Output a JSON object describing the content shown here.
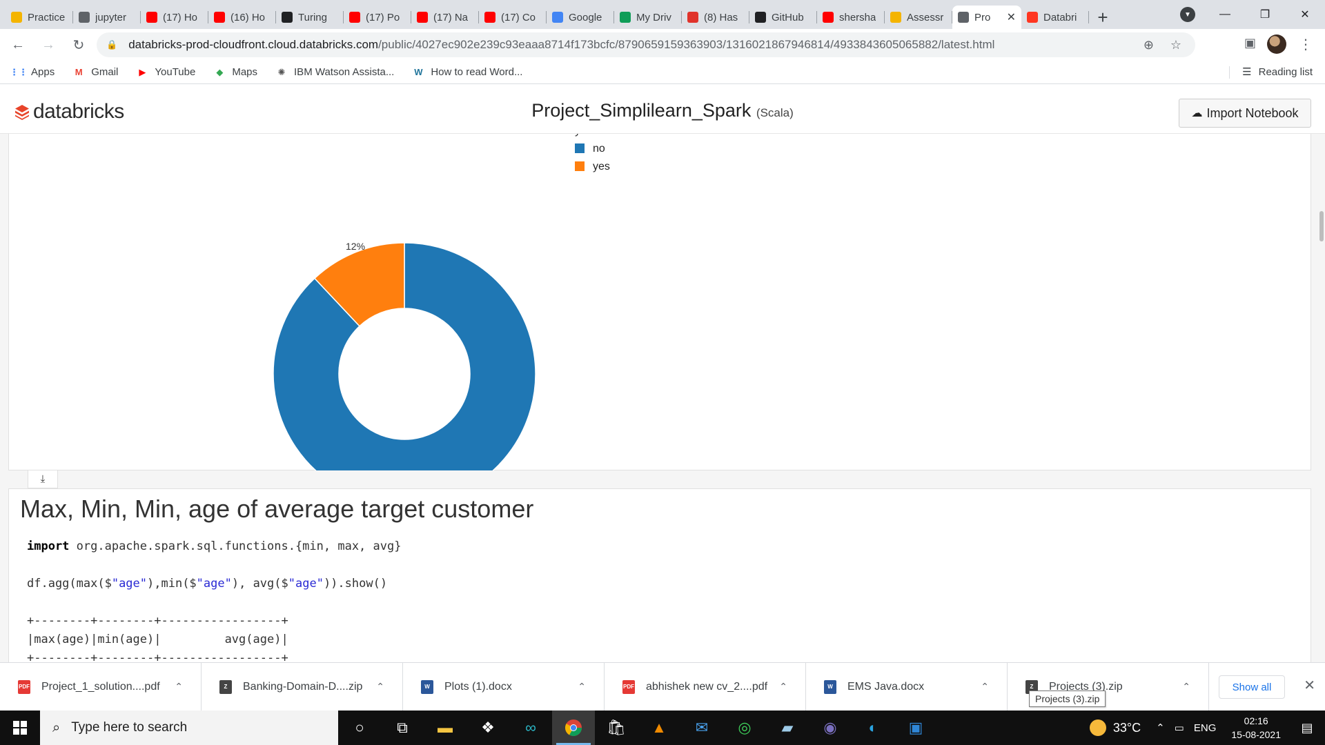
{
  "browser": {
    "tabs": [
      {
        "title": "Practice",
        "icon": "chart-bars-icon",
        "color": "#f4b400"
      },
      {
        "title": "jupyter",
        "icon": "globe-icon",
        "color": "#5f6368"
      },
      {
        "title": "(17) Ho",
        "icon": "youtube-icon",
        "color": "#ff0000"
      },
      {
        "title": "(16) Ho",
        "icon": "youtube-icon",
        "color": "#ff0000"
      },
      {
        "title": "Turing",
        "icon": "turing-icon",
        "color": "#202124"
      },
      {
        "title": "(17) Po",
        "icon": "youtube-icon",
        "color": "#ff0000"
      },
      {
        "title": "(17) Na",
        "icon": "youtube-icon",
        "color": "#ff0000"
      },
      {
        "title": "(17) Co",
        "icon": "youtube-icon",
        "color": "#ff0000"
      },
      {
        "title": "Google",
        "icon": "google-icon",
        "color": "#4285f4"
      },
      {
        "title": "My Driv",
        "icon": "drive-icon",
        "color": "#0f9d58"
      },
      {
        "title": "(8) Has",
        "icon": "q-icon",
        "color": "#e0332b"
      },
      {
        "title": "GitHub",
        "icon": "github-icon",
        "color": "#202124"
      },
      {
        "title": "shersha",
        "icon": "youtube-icon",
        "color": "#ff0000"
      },
      {
        "title": "Assessr",
        "icon": "chart-bars-icon",
        "color": "#f4b400"
      },
      {
        "title": "Pro",
        "icon": "globe-icon",
        "color": "#5f6368",
        "active": true
      },
      {
        "title": "Databri",
        "icon": "databricks-icon",
        "color": "#ff3621"
      }
    ],
    "url_host": "databricks-prod-cloudfront.cloud.databricks.com",
    "url_path": "/public/4027ec902e239c93eaaa8714f173bcfc/8790659159363903/1316021867946814/4933843605065882/latest.html",
    "bookmarks": [
      {
        "label": "Apps",
        "icon": "apps-grid-icon"
      },
      {
        "label": "Gmail",
        "icon": "gmail-icon"
      },
      {
        "label": "YouTube",
        "icon": "youtube-icon"
      },
      {
        "label": "Maps",
        "icon": "maps-icon"
      },
      {
        "label": "IBM Watson Assista...",
        "icon": "watson-icon"
      },
      {
        "label": "How to read Word...",
        "icon": "wordpress-icon"
      }
    ],
    "reading_list": "Reading list"
  },
  "notebook": {
    "logo_text": "databricks",
    "title": "Project_Simplilearn_Spark",
    "language": "(Scala)",
    "import_label": "Import Notebook",
    "heading": "Max, Min, Min, age of average target customer",
    "code_line1_kw": "import",
    "code_line1_rest": " org.apache.spark.sql.functions.{min, max, avg}",
    "code_line2_a": "df.agg(max($",
    "code_line2_s1": "\"age\"",
    "code_line2_b": "),min($",
    "code_line2_s2": "\"age\"",
    "code_line2_c": "), avg($",
    "code_line2_s3": "\"age\"",
    "code_line2_d": ")).show()",
    "table_border": "+--------+--------+-----------------+",
    "table_header": "|max(age)|min(age)|         avg(age)|",
    "table_border2": "+--------+--------+-----------------+"
  },
  "chart_data": {
    "type": "pie",
    "donut": true,
    "legend_title": "y",
    "legend_position": "right",
    "slices": [
      {
        "label": "no",
        "value": 88,
        "display": "88%",
        "color": "#1f77b4"
      },
      {
        "label": "yes",
        "value": 12,
        "display": "12%",
        "color": "#ff7f0e"
      }
    ]
  },
  "downloads": [
    {
      "name": "Project_1_solution....pdf",
      "icon": "pdf-icon",
      "color": "#e53935"
    },
    {
      "name": "Banking-Domain-D....zip",
      "icon": "zip-icon",
      "color": "#444444"
    },
    {
      "name": "Plots (1).docx",
      "icon": "word-icon",
      "color": "#2b579a"
    },
    {
      "name": "abhishek new cv_2....pdf",
      "icon": "pdf-icon",
      "color": "#e53935"
    },
    {
      "name": "EMS Java.docx",
      "icon": "word-icon",
      "color": "#2b579a"
    },
    {
      "name": "Projects (3).zip",
      "icon": "zip-icon",
      "color": "#444444"
    }
  ],
  "download_tooltip": "Projects (3).zip",
  "show_all": "Show all",
  "taskbar": {
    "search_placeholder": "Type here to search",
    "temperature": "33°C",
    "lang": "ENG",
    "time": "02:16",
    "date": "15-08-2021"
  }
}
